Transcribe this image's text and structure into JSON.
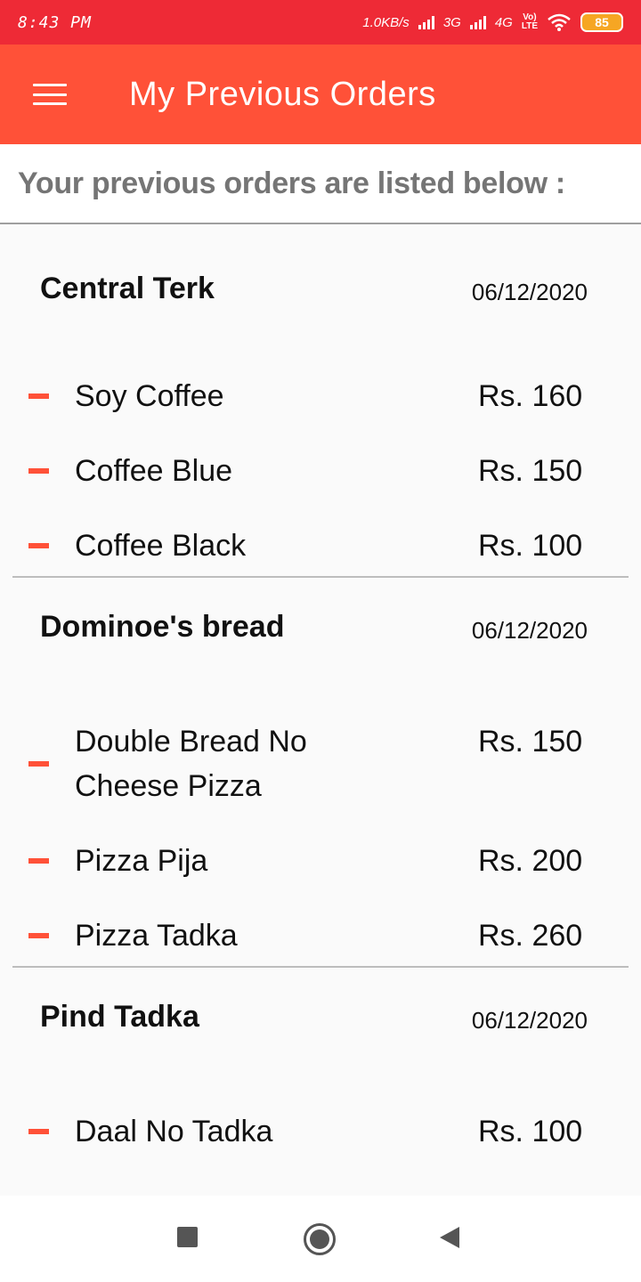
{
  "status_bar": {
    "time": "8:43 PM",
    "speed": "1.0KB/s",
    "network1": "3G",
    "network2": "4G",
    "volte_top": "Vo)",
    "volte_bottom": "LTE",
    "battery": "85"
  },
  "app_bar": {
    "title": "My Previous Orders",
    "menu_icon": "menu-icon"
  },
  "subheader": "Your previous orders are listed below :",
  "orders": [
    {
      "restaurant": "Central Terk",
      "date": "06/12/2020",
      "items": [
        {
          "name": "Soy Coffee",
          "price": "Rs. 160"
        },
        {
          "name": "Coffee Blue",
          "price": "Rs. 150"
        },
        {
          "name": "Coffee Black",
          "price": "Rs. 100"
        }
      ]
    },
    {
      "restaurant": "Dominoe's bread",
      "date": "06/12/2020",
      "items": [
        {
          "name": "Double Bread No Cheese Pizza",
          "price": "Rs. 150"
        },
        {
          "name": "Pizza Pija",
          "price": "Rs. 200"
        },
        {
          "name": "Pizza Tadka",
          "price": "Rs. 260"
        }
      ]
    },
    {
      "restaurant": "Pind Tadka",
      "date": "06/12/2020",
      "items": [
        {
          "name": "Daal No Tadka",
          "price": "Rs. 100"
        }
      ]
    }
  ],
  "colors": {
    "status_bar": "#ee2a36",
    "accent": "#ff5138",
    "battery": "#f6a623"
  }
}
